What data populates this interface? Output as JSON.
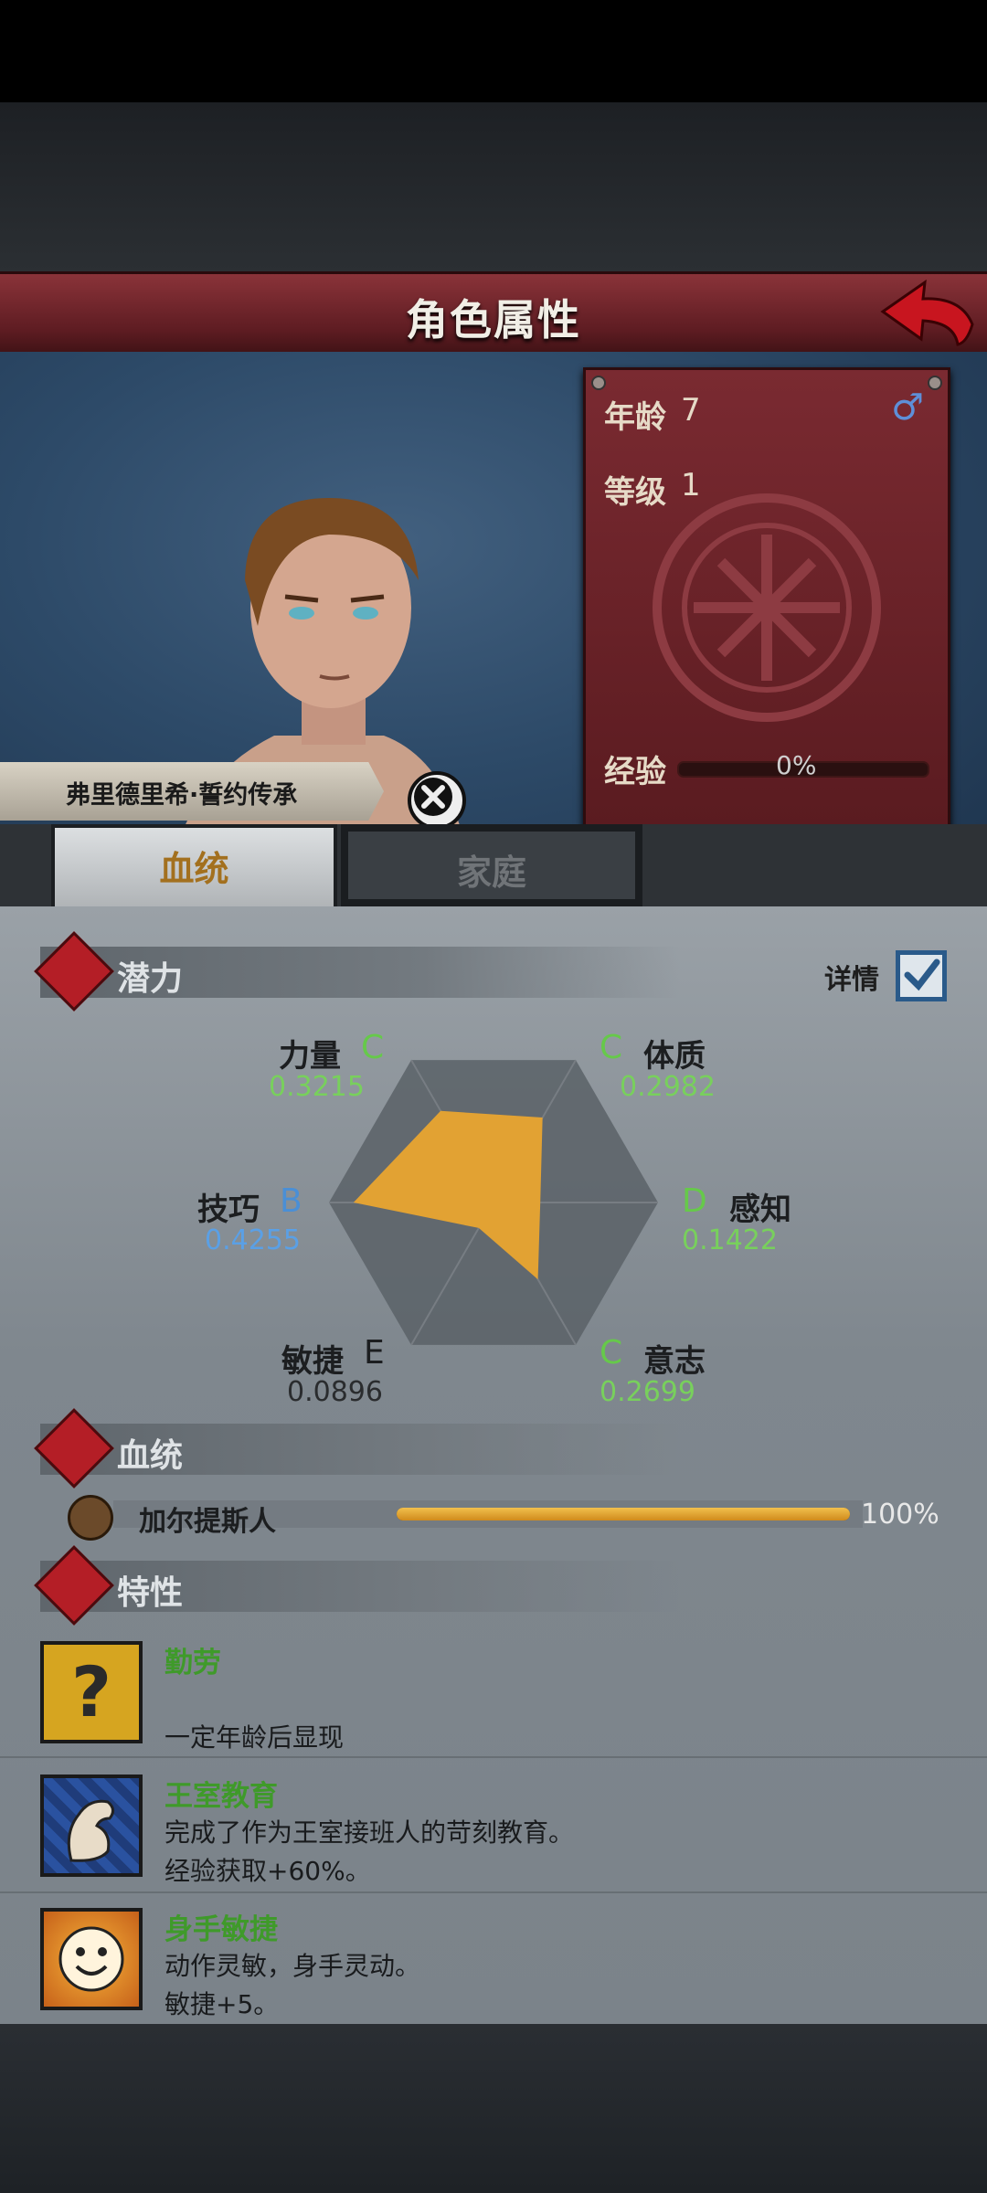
{
  "header": {
    "title": "角色属性"
  },
  "profile": {
    "age_label": "年龄",
    "age_value": "7",
    "level_label": "等级",
    "level_value": "1",
    "gender_symbol": "♂",
    "exp_label": "经验",
    "exp_value": "0%",
    "exp_fraction": 0,
    "name": "弗里德里希·誓约传承"
  },
  "tabs": [
    {
      "label": "血统",
      "active": true
    },
    {
      "label": "家庭",
      "active": false
    }
  ],
  "potential": {
    "title": "潜力",
    "detail_label": "详情",
    "detail_checked": true,
    "stats": [
      {
        "name": "力量",
        "grade": "C",
        "value": "0.3215",
        "v": 0.3215
      },
      {
        "name": "体质",
        "grade": "C",
        "value": "0.2982",
        "v": 0.2982
      },
      {
        "name": "感知",
        "grade": "D",
        "value": "0.1422",
        "v": 0.1422
      },
      {
        "name": "意志",
        "grade": "C",
        "value": "0.2699",
        "v": 0.2699
      },
      {
        "name": "敏捷",
        "grade": "E",
        "value": "0.0896",
        "v": 0.0896
      },
      {
        "name": "技巧",
        "grade": "B",
        "value": "0.4255",
        "v": 0.4255
      }
    ]
  },
  "bloodline": {
    "title": "血统",
    "items": [
      {
        "name": "加尔提斯人",
        "percent": "100%",
        "fraction": 1.0
      }
    ]
  },
  "traits": {
    "title": "特性",
    "items": [
      {
        "name": "勤劳",
        "desc1": "",
        "desc2": "一定年龄后显现",
        "icon": "question-icon"
      },
      {
        "name": "王室教育",
        "desc1": "完成了作为王室接班人的苛刻教育。",
        "desc2": "经验获取+60%。",
        "icon": "muscle-arm-icon"
      },
      {
        "name": "身手敏捷",
        "desc1": "动作灵敏，身手灵动。",
        "desc2": "敏捷+5。",
        "icon": "smiley-icon"
      }
    ]
  },
  "colors": {
    "grade_C": "#66c94a",
    "grade_B": "#4a8fd6",
    "grade_D": "#66c94a",
    "grade_E": "#1c1e20",
    "val_green": "#78d05c",
    "val_blue": "#5aa0e6",
    "val_gray": "#2a2c2e",
    "radar_fill": "#e2a233"
  }
}
